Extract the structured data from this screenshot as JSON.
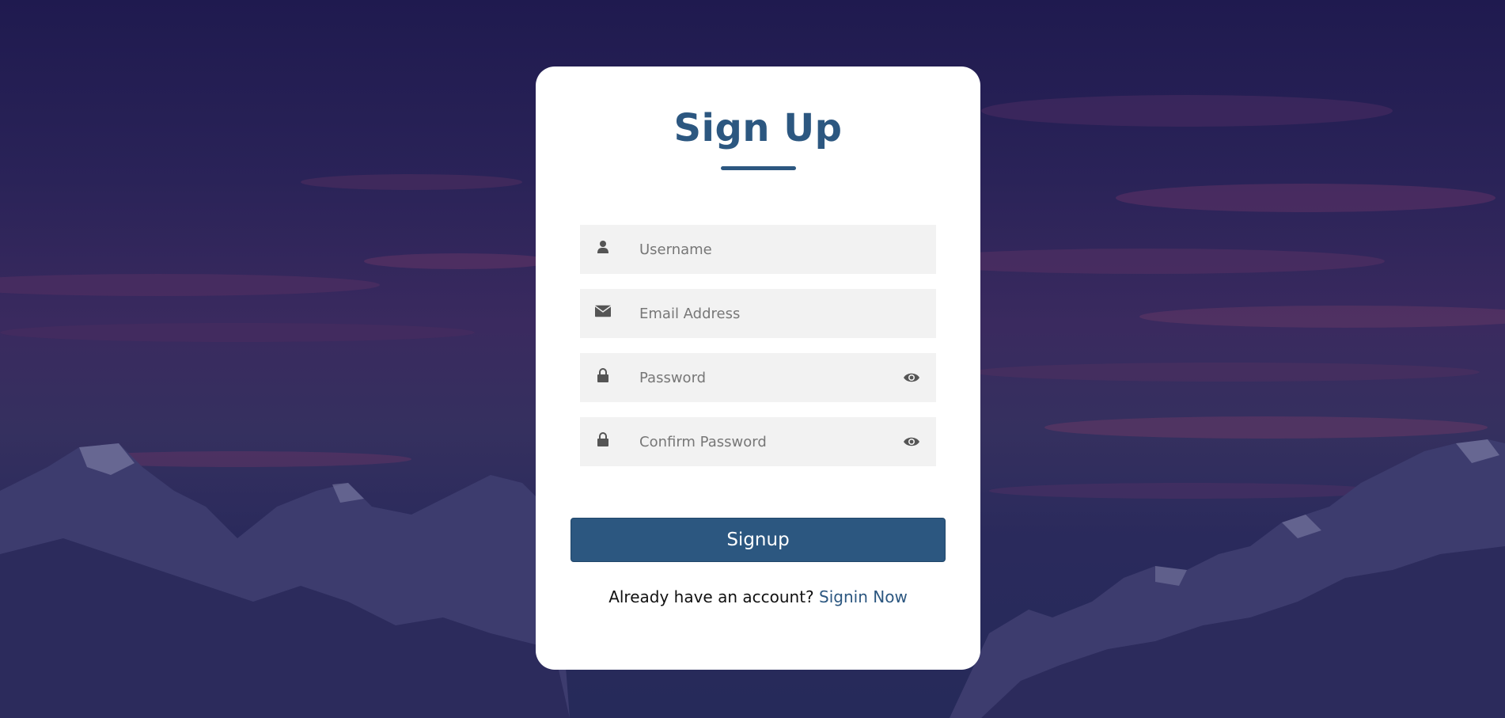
{
  "colors": {
    "accent": "#2c5780",
    "card_bg": "#ffffff",
    "field_bg": "#f2f2f2",
    "icon": "#555555"
  },
  "form": {
    "title": "Sign Up",
    "fields": [
      {
        "name": "username",
        "placeholder": "Username",
        "value": "",
        "icon": "user-icon"
      },
      {
        "name": "email",
        "placeholder": "Email Address",
        "value": "",
        "icon": "envelope-icon"
      },
      {
        "name": "password",
        "placeholder": "Password",
        "value": "",
        "icon": "lock-icon",
        "toggle_icon": "eye-icon"
      },
      {
        "name": "confirm_password",
        "placeholder": "Confirm Password",
        "value": "",
        "icon": "lock-icon",
        "toggle_icon": "eye-icon"
      }
    ],
    "submit_label": "Signup",
    "footer_text": "Already have an account?",
    "footer_link": "Signin Now"
  }
}
